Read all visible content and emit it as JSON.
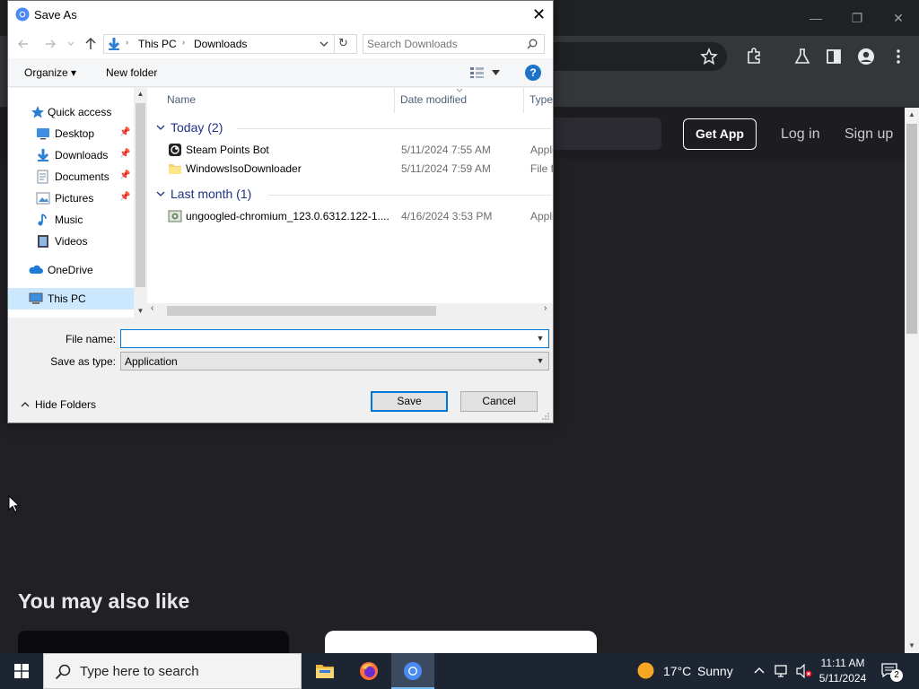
{
  "browser": {
    "window_controls": {
      "minimize": "—",
      "restore": "❐",
      "close": "✕"
    },
    "toolbar_icons": [
      "bookmark-star-icon",
      "extensions-icon",
      "labs-flask-icon",
      "side-panel-icon",
      "profile-icon",
      "menu-icon"
    ]
  },
  "page": {
    "header": {
      "get_app": "Get App",
      "log_in": "Log in",
      "sign_up": "Sign up"
    },
    "section_title": "You may also like"
  },
  "dialog": {
    "title": "Save As",
    "close": "✕",
    "address": {
      "crumbs": [
        "This PC",
        "Downloads"
      ],
      "refresh": "↻"
    },
    "search_placeholder": "Search Downloads",
    "commands": {
      "organize": "Organize ▾",
      "new_folder": "New folder",
      "help": "?"
    },
    "nav": {
      "quick_access": "Quick access",
      "items": [
        {
          "label": "Desktop",
          "pinned": true
        },
        {
          "label": "Downloads",
          "pinned": true
        },
        {
          "label": "Documents",
          "pinned": true
        },
        {
          "label": "Pictures",
          "pinned": true
        },
        {
          "label": "Music",
          "pinned": false
        },
        {
          "label": "Videos",
          "pinned": false
        }
      ],
      "onedrive": "OneDrive",
      "this_pc": "This PC"
    },
    "columns": {
      "name": "Name",
      "date": "Date modified",
      "type": "Type"
    },
    "groups": [
      {
        "label": "Today (2)",
        "files": [
          {
            "name": "Steam Points Bot",
            "date": "5/11/2024 7:55 AM",
            "type": "Application",
            "icon": "steam-app-icon"
          },
          {
            "name": "WindowsIsoDownloader",
            "date": "5/11/2024 7:59 AM",
            "type": "File folder",
            "icon": "folder-icon"
          }
        ]
      },
      {
        "label": "Last month (1)",
        "files": [
          {
            "name": "ungoogled-chromium_123.0.6312.122-1....",
            "date": "4/16/2024 3:53 PM",
            "type": "Application",
            "icon": "installer-icon"
          }
        ]
      }
    ],
    "file_name_label": "File name:",
    "file_name_value": "",
    "save_as_type_label": "Save as type:",
    "save_as_type_value": "Application",
    "hide_folders": "Hide Folders",
    "save": "Save",
    "cancel": "Cancel"
  },
  "taskbar": {
    "search_placeholder": "Type here to search",
    "weather": {
      "temp": "17°C",
      "condition": "Sunny"
    },
    "clock": {
      "time": "11:11 AM",
      "date": "5/11/2024"
    },
    "notifications": "2"
  },
  "colors": {
    "accent": "#0078d7",
    "selection": "#cce8ff",
    "taskbar": "#1c2531",
    "page_bg": "#212025"
  }
}
